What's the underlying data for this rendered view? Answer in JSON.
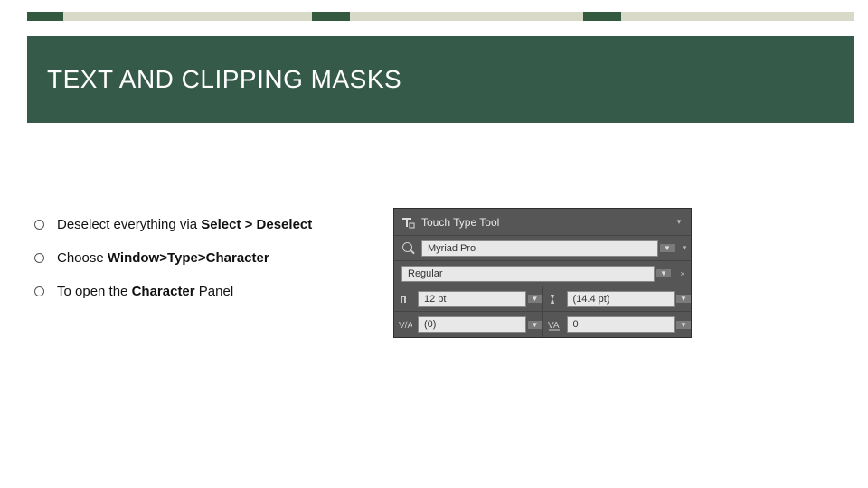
{
  "header": {
    "title": "TEXT AND CLIPPING MASKS"
  },
  "bullets": [
    {
      "pre": "Deselect everything via ",
      "bold": "Select > Deselect",
      "post": ""
    },
    {
      "pre": "Choose  ",
      "bold": "Window>Type>Character",
      "post": ""
    },
    {
      "pre": "To open the ",
      "bold": "Character",
      "post": " Panel"
    }
  ],
  "panel": {
    "tool_label": "Touch Type Tool",
    "font_family": "Myriad Pro",
    "font_style": "Regular",
    "size": "12 pt",
    "leading": "(14.4 pt)",
    "kerning": "(0)",
    "tracking": "0"
  }
}
